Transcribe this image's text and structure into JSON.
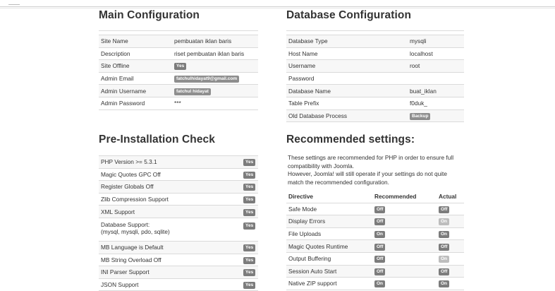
{
  "main_config": {
    "title": "Main Configuration",
    "rows": [
      {
        "label": "Site Name",
        "value": "pembuatan iklan baris"
      },
      {
        "label": "Description",
        "value": "riset pembuatan iklan baris"
      },
      {
        "label": "Site Offline",
        "badge": "Yes"
      },
      {
        "label": "Admin Email",
        "badge": "fatchulhidayat9@gmail.com"
      },
      {
        "label": "Admin Username",
        "badge": "fatchul hidayat"
      },
      {
        "label": "Admin Password",
        "value": "***"
      }
    ]
  },
  "db_config": {
    "title": "Database Configuration",
    "rows": [
      {
        "label": "Database Type",
        "value": "mysqli"
      },
      {
        "label": "Host Name",
        "value": "localhost"
      },
      {
        "label": "Username",
        "value": "root"
      },
      {
        "label": "Password",
        "value": ""
      },
      {
        "label": "Database Name",
        "value": "buat_iklan"
      },
      {
        "label": "Table Prefix",
        "value": "f0duk_"
      },
      {
        "label": "Old Database Process",
        "badge": "Backup"
      }
    ]
  },
  "preinstall": {
    "title": "Pre-Installation Check",
    "rows": [
      {
        "label": "PHP Version >= 5.3.1",
        "badge": "Yes"
      },
      {
        "label": "Magic Quotes GPC Off",
        "badge": "Yes"
      },
      {
        "label": "Register Globals Off",
        "badge": "Yes"
      },
      {
        "label": "Zlib Compression Support",
        "badge": "Yes"
      },
      {
        "label": "XML Support",
        "badge": "Yes"
      },
      {
        "label": "Database Support:",
        "label2": "(mysql, mysqli, pdo, sqlite)",
        "badge": "Yes"
      },
      {
        "label": "MB Language is Default",
        "badge": "Yes"
      },
      {
        "label": "MB String Overload Off",
        "badge": "Yes"
      },
      {
        "label": "INI Parser Support",
        "badge": "Yes"
      },
      {
        "label": "JSON Support",
        "badge": "Yes"
      }
    ]
  },
  "recommended": {
    "title": "Recommended settings:",
    "intro1": "These settings are recommended for PHP in order to ensure full compatibility with Joomla.",
    "intro2": "However, Joomla! will still operate if your settings do not quite match the recommended configuration.",
    "headers": {
      "directive": "Directive",
      "recommended": "Recommended",
      "actual": "Actual"
    },
    "rows": [
      {
        "directive": "Safe Mode",
        "recommended": "Off",
        "actual": "Off",
        "actual_ok": true
      },
      {
        "directive": "Display Errors",
        "recommended": "Off",
        "actual": "On",
        "actual_ok": false
      },
      {
        "directive": "File Uploads",
        "recommended": "On",
        "actual": "On",
        "actual_ok": true
      },
      {
        "directive": "Magic Quotes Runtime",
        "recommended": "Off",
        "actual": "Off",
        "actual_ok": true
      },
      {
        "directive": "Output Buffering",
        "recommended": "Off",
        "actual": "On",
        "actual_ok": false
      },
      {
        "directive": "Session Auto Start",
        "recommended": "Off",
        "actual": "Off",
        "actual_ok": true
      },
      {
        "directive": "Native ZIP support",
        "recommended": "On",
        "actual": "On",
        "actual_ok": true
      }
    ]
  }
}
